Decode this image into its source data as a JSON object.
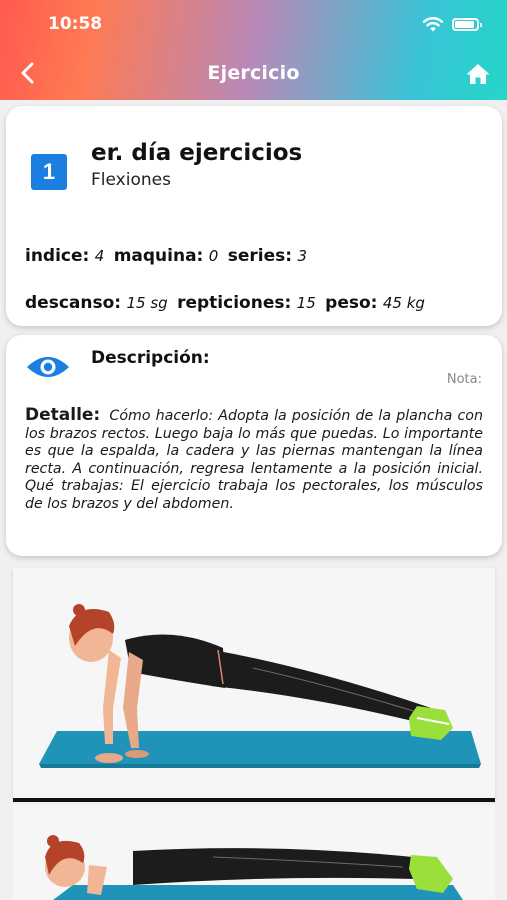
{
  "status_bar": {
    "time": "10:58"
  },
  "nav": {
    "title": "Ejercicio"
  },
  "exercise": {
    "day_number": "1",
    "title": "er. día ejercicios",
    "subtitle": "Flexiones",
    "stats": {
      "indice_label": "indice:",
      "indice_value": "4",
      "maquina_label": "maquina:",
      "maquina_value": "0",
      "series_label": "series:",
      "series_value": "3",
      "descanso_label": "descanso:",
      "descanso_value": "15 sg",
      "repeticiones_label": "repticiones:",
      "repeticiones_value": "15",
      "peso_label": "peso:",
      "peso_value": "45 kg"
    }
  },
  "description": {
    "title": "Descripción:",
    "note_label": "Nota:",
    "detail_label": "Detalle:",
    "detail_text": "Cómo hacerlo: Adopta la posición de la plancha con los brazos rectos. Luego baja lo más que puedas. Lo importante es que la espalda, la cadera y las piernas mantengan la línea recta. A continuación, regresa lentamente a la posición inicial.  Qué trabajas: El ejercicio trabaja los pectorales, los músculos de los brazos y del abdomen."
  },
  "icons": {
    "back": "chevron-left-icon",
    "home": "home-icon",
    "description": "eye-icon",
    "wifi": "wifi-icon",
    "battery": "battery-icon"
  },
  "colors": {
    "header_gradient": [
      "#ff5a4f",
      "#b889b8",
      "#24d6c7"
    ],
    "badge": "#1a7fe0",
    "eye": "#1a7fe0",
    "mat": "#1f93b8",
    "shoe": "#9be03a"
  }
}
